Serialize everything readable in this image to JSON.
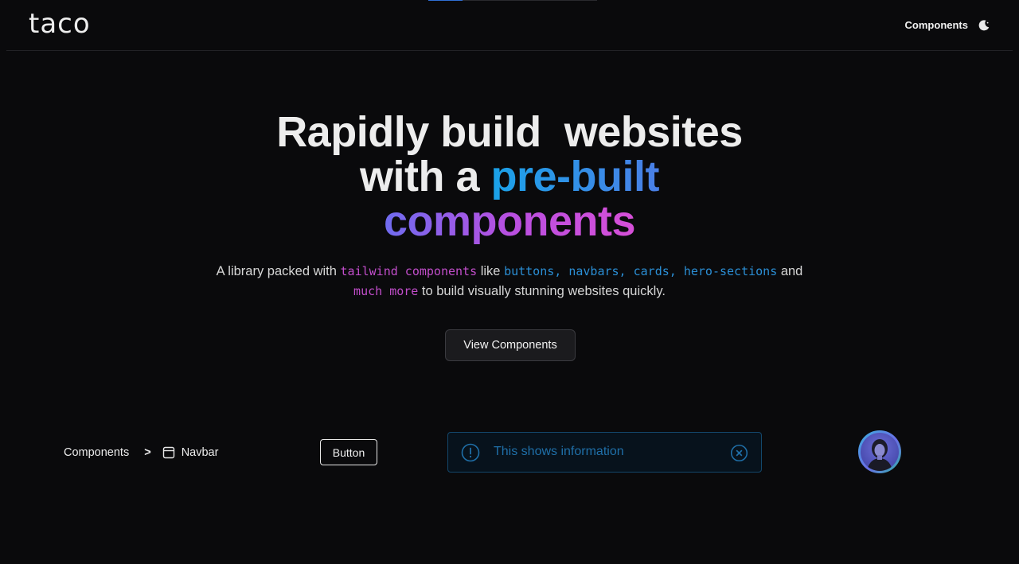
{
  "brand": {
    "logo_text": "taco"
  },
  "nav": {
    "components_link": "Components",
    "theme_icon": "moon-icon"
  },
  "hero": {
    "line1": "Rapidly build  websites",
    "line2_plain": "with a ",
    "line2_gradient": "pre-built",
    "line3_gradient": "components"
  },
  "subtitle": {
    "part1": "A library packed with ",
    "code1": "tailwind components",
    "part2": " like ",
    "code2": "buttons, navbars, cards, hero-sections",
    "part3": " and",
    "code3": "much more",
    "part4": " to build visually stunning websites quickly."
  },
  "cta": {
    "label": "View Components"
  },
  "breadcrumb": {
    "item1": "Components",
    "separator": ">",
    "item2": "Navbar",
    "item2_icon": "window-icon"
  },
  "demo_button": {
    "label": "Button"
  },
  "alert": {
    "text": "This shows information",
    "icon": "info-icon",
    "close_icon": "close-circle-icon"
  },
  "colors": {
    "background": "#0a0a0c",
    "accent_blue": "#1aa2e8",
    "accent_purple": "#b84fe0",
    "code_pink": "#c24ecb",
    "code_blue": "#2b8fd6",
    "alert_border": "#13476b",
    "alert_text": "#1f6fa8"
  }
}
